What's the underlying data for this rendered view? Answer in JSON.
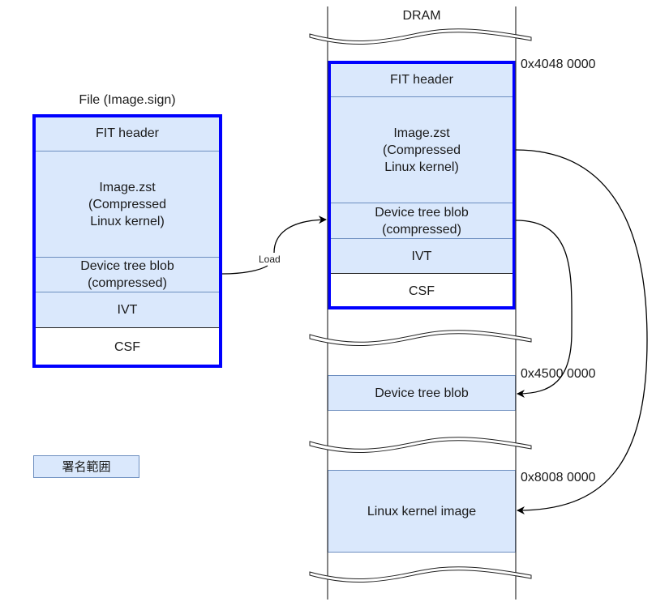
{
  "file": {
    "title": "File (Image.sign)",
    "sections": [
      {
        "label": "FIT header",
        "fill": "blue"
      },
      {
        "label": "Image.zst\n(Compressed\nLinux kernel)",
        "fill": "blue"
      },
      {
        "label": "Device tree blob\n(compressed)",
        "fill": "blue"
      },
      {
        "label": "IVT",
        "fill": "blue"
      },
      {
        "label": "CSF",
        "fill": "white"
      }
    ]
  },
  "load_arrow": {
    "label": "Load"
  },
  "dram": {
    "title": "DRAM",
    "signed_region": {
      "address": "0x4048 0000",
      "sections": [
        {
          "label": "FIT header",
          "fill": "blue"
        },
        {
          "label": "Image.zst\n(Compressed\nLinux kernel)",
          "fill": "blue"
        },
        {
          "label": "Device tree blob\n(compressed)",
          "fill": "blue"
        },
        {
          "label": "IVT",
          "fill": "blue"
        },
        {
          "label": "CSF",
          "fill": "white"
        }
      ]
    },
    "dtb_region": {
      "address": "0x4500 0000",
      "label": "Device tree blob"
    },
    "kernel_region": {
      "address": "0x8008 0000",
      "label": "Linux kernel image"
    }
  },
  "legend": {
    "label": "署名範囲",
    "meaning": "signed range"
  },
  "colors": {
    "section_fill": "#dae8fc",
    "section_border": "#6c8ebf",
    "signed_frame": "#0000ff",
    "line": "#000000"
  }
}
